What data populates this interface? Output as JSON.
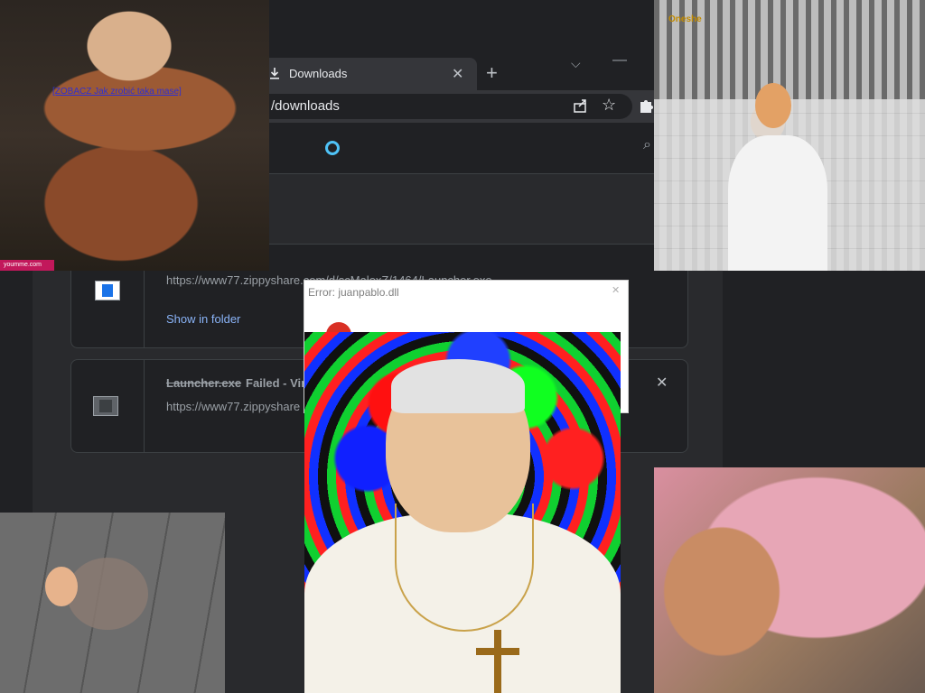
{
  "browser": {
    "tab": {
      "title": "Downloads"
    },
    "address_bar": {
      "url": "/downloads"
    }
  },
  "downloads": {
    "items": [
      {
        "url": "https://www77.zippyshare.com/d/scMalexZ/1464/Launcher.exe",
        "action": "Show in folder"
      },
      {
        "filename": "Launcher.exe",
        "status": "Failed - Vir",
        "url": "https://www77.zippyshare"
      }
    ]
  },
  "dialog": {
    "title": "Error: juanpablo.dll"
  },
  "overlays": {
    "bodybuilder_caption": "[ZOBACZ Jak zrobić taka mase]",
    "bodybuilder_watermark": "youmme.com",
    "butcher_logo": "Oneshe"
  },
  "icons": {
    "tab": "download-icon",
    "tab_close": "close-icon",
    "new_tab": "plus-icon",
    "share": "share-icon",
    "bookmark": "star-icon",
    "extensions": "puzzle-icon",
    "search": "search-icon"
  },
  "colors": {
    "accent": "#8ab4f8",
    "spinner": "#4fc3f7",
    "background": "#202124"
  }
}
